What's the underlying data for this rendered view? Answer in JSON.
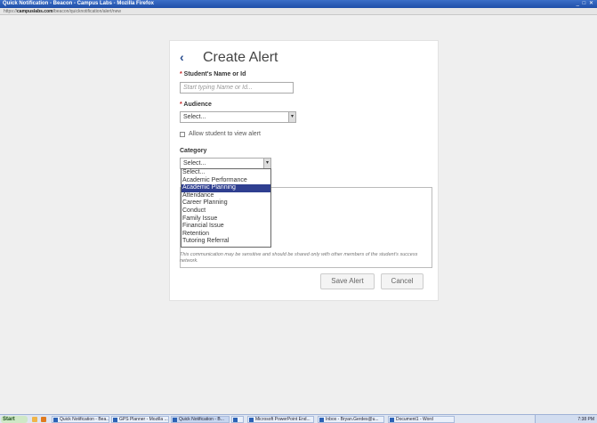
{
  "window": {
    "title": "Quick Notification - Beacon - Campus Labs - Mozilla Firefox",
    "controls": "_ □ ✕",
    "url_prefix": "https://",
    "url_domain": "campuslabs.com",
    "url_path": "/beacon/quicknotification/alert/new"
  },
  "form": {
    "back_glyph": "‹",
    "title": "Create Alert",
    "student_label": "Student's Name or Id",
    "student_placeholder": "Start typing Name or Id...",
    "audience_label": "Audience",
    "audience_value": "Select...",
    "allow_label": "Allow student to view alert",
    "category_label": "Category",
    "category_value": "Select...",
    "note": "This communication may be sensitive and should be shared only with other members of the student's success network.",
    "save_label": "Save Alert",
    "cancel_label": "Cancel"
  },
  "category_options": [
    "Select...",
    "Academic Performance",
    "Academic Planning",
    "Attendance",
    "Career Planning",
    "Conduct",
    "Family Issue",
    "Financial Issue",
    "Retention",
    "Tutoring Referral"
  ],
  "category_highlighted": "Academic Planning",
  "taskbar": {
    "start_label": "Start",
    "items": [
      "Quick Notification - Bea...",
      "GPS Planner - Mozilla ...",
      "Quick Notification - B...",
      "",
      "Microsoft PowerPoint End...",
      "Inbox - Bryan.Gerdes@u...",
      "Document1 - Word"
    ],
    "clock": "7:38 PM"
  },
  "colors": {
    "accent": "#2a4d8f",
    "required": "#c82020",
    "highlight": "#2f3f90"
  }
}
